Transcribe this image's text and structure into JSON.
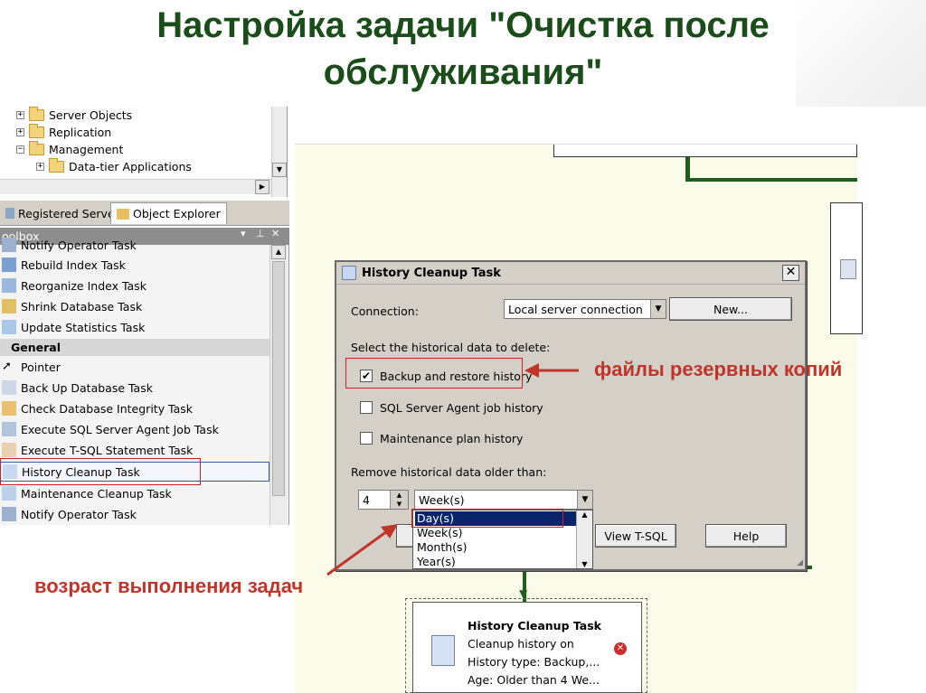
{
  "title": {
    "line1": "Настройка задачи \"Очистка после",
    "line2": "обслуживания\""
  },
  "tree": {
    "items": [
      {
        "label": "Server Objects",
        "expander": "+"
      },
      {
        "label": "Replication",
        "expander": "+"
      },
      {
        "label": "Management",
        "expander": "−"
      },
      {
        "label": "Data-tier Applications",
        "expander": "+"
      }
    ]
  },
  "tabs": {
    "registered": "Registered Servers",
    "explorer": "Object Explorer"
  },
  "toolbox": {
    "header": "oolbox",
    "top_cut": "Notify Operator Task",
    "items_a": [
      "Rebuild Index Task",
      "Reorganize Index Task",
      "Shrink Database Task",
      "Update Statistics Task"
    ],
    "group": "General",
    "items_b": [
      "Pointer",
      "Back Up Database Task",
      "Check Database Integrity Task",
      "Execute SQL Server Agent Job Task",
      "Execute T-SQL Statement Task",
      "History Cleanup Task",
      "Maintenance Cleanup Task",
      "Notify Operator Task"
    ]
  },
  "dialog": {
    "title": "History Cleanup Task",
    "connection_label": "Connection:",
    "connection_value": "Local server connection",
    "new_button": "New...",
    "select_label": "Select the historical data to delete:",
    "checks": [
      {
        "label": "Backup and restore history",
        "checked": true
      },
      {
        "label": "SQL Server Agent job history",
        "checked": false
      },
      {
        "label": "Maintenance plan history",
        "checked": false
      }
    ],
    "older_label": "Remove historical data older than:",
    "age_value": "4",
    "unit_value": "Week(s)",
    "unit_options": [
      "Day(s)",
      "Week(s)",
      "Month(s)",
      "Year(s)"
    ],
    "view_tsql": "View T-SQL",
    "help": "Help"
  },
  "annotations": {
    "backup": "файлы резервных копий",
    "age": "возраст выполнения задач"
  },
  "node": {
    "title": "History Cleanup Task",
    "line1": "Cleanup history on",
    "line2": "History type: Backup,...",
    "line3": "Age: Older than 4 We..."
  },
  "colors": {
    "title": "#1b4d1b",
    "annotation": "#c0342a",
    "connector": "#1f5e1f",
    "selection": "#0a246a"
  }
}
